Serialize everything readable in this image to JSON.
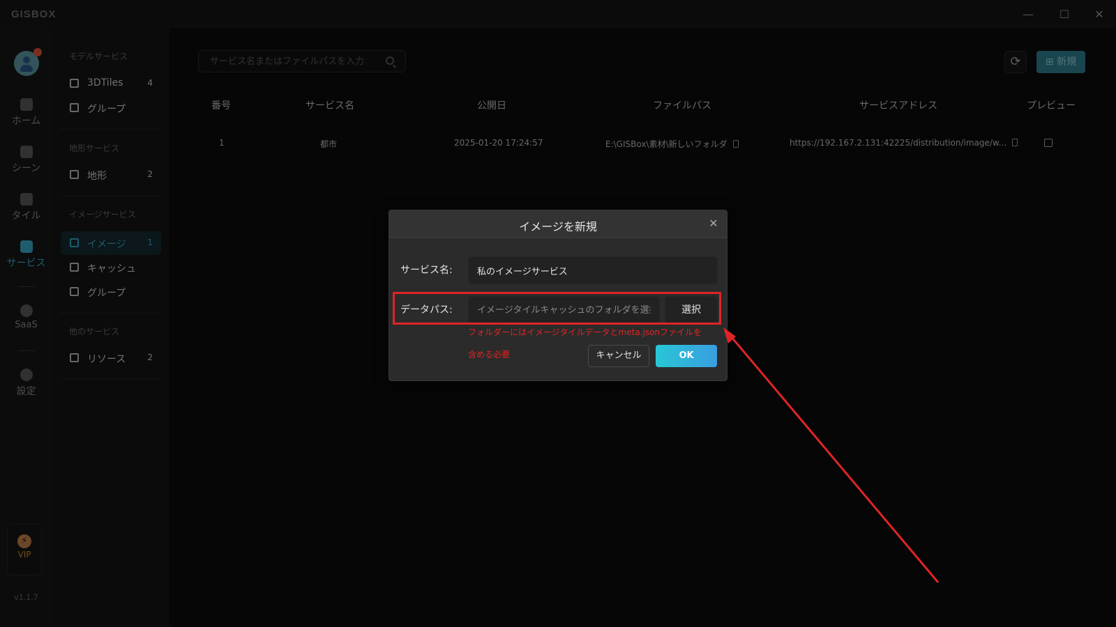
{
  "app": {
    "logo": "GISBOX"
  },
  "window_controls": {
    "minimize": "—",
    "maximize": "☐",
    "close": "✕"
  },
  "rail": {
    "items": [
      {
        "label": "ホーム"
      },
      {
        "label": "シーン"
      },
      {
        "label": "タイル"
      },
      {
        "label": "サービス"
      },
      {
        "label": "SaaS"
      },
      {
        "label": "設定"
      }
    ],
    "vip": "VIP",
    "version": "v1.1.7"
  },
  "sidebar": {
    "sections": [
      {
        "title": "モデルサービス"
      },
      {
        "title": "地形サービス"
      },
      {
        "title": "イメージサービス"
      },
      {
        "title": "他のサービス"
      }
    ],
    "items": [
      {
        "label": "3DTiles",
        "count": "4"
      },
      {
        "label": "グループ",
        "count": ""
      },
      {
        "label": "地形",
        "count": "2"
      },
      {
        "label": "イメージ",
        "count": "1"
      },
      {
        "label": "キャッシュ",
        "count": ""
      },
      {
        "label": "グループ",
        "count": ""
      },
      {
        "label": "リソース",
        "count": "2"
      }
    ]
  },
  "toolbar": {
    "search_placeholder": "サービス名またはファイルパスを入力",
    "refresh_icon": "⟳",
    "new_label": "新規",
    "new_icon": "⊞"
  },
  "table": {
    "headers": [
      "番号",
      "サービス名",
      "公開日",
      "ファイルパス",
      "サービスアドレス",
      "プレビュー"
    ],
    "rows": [
      {
        "no": "1",
        "name": "都市",
        "date": "2025-01-20 17:24:57",
        "path": "E:\\GISBox\\素材\\新しいフォルダ",
        "address": "https://192.167.2.131:42225/distribution/image/w..."
      }
    ]
  },
  "modal": {
    "title": "イメージを新規",
    "close_icon": "✕",
    "service_name_label": "サービス名:",
    "service_name_value": "私のイメージサービス",
    "data_path_label": "データパス:",
    "data_path_placeholder": "イメージタイルキャッシュのフォルダを選択",
    "select_label": "選択",
    "error_line1": "フォルダーにはイメージタイルデータとmeta.jsonファイルを",
    "error_line2": "含める必要",
    "cancel_label": "キャンセル",
    "ok_label": "OK"
  },
  "colors": {
    "accent": "#3aa8c7",
    "highlight": "#e02424"
  }
}
